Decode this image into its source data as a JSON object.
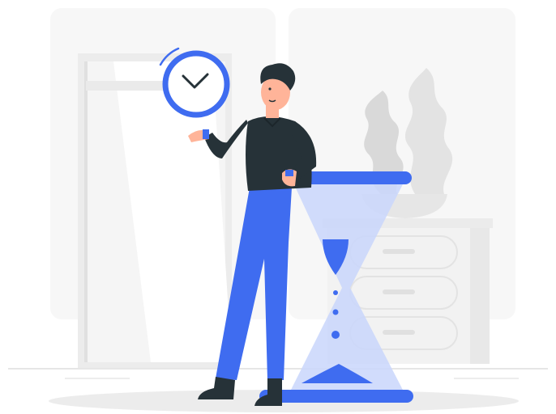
{
  "illustration": {
    "subject": "man-leaning-on-hourglass-holding-clock",
    "icons": [
      "clock-icon",
      "hourglass-icon"
    ],
    "colors": {
      "accent": "#3f6cf0",
      "accent_light": "#c9d6fb",
      "shirt": "#263238",
      "skin": "#ffb499",
      "hair": "#263238",
      "background_shapes": "#f3f3f3",
      "background_lines": "#e6e6e6",
      "shadow": "#ececec"
    }
  }
}
